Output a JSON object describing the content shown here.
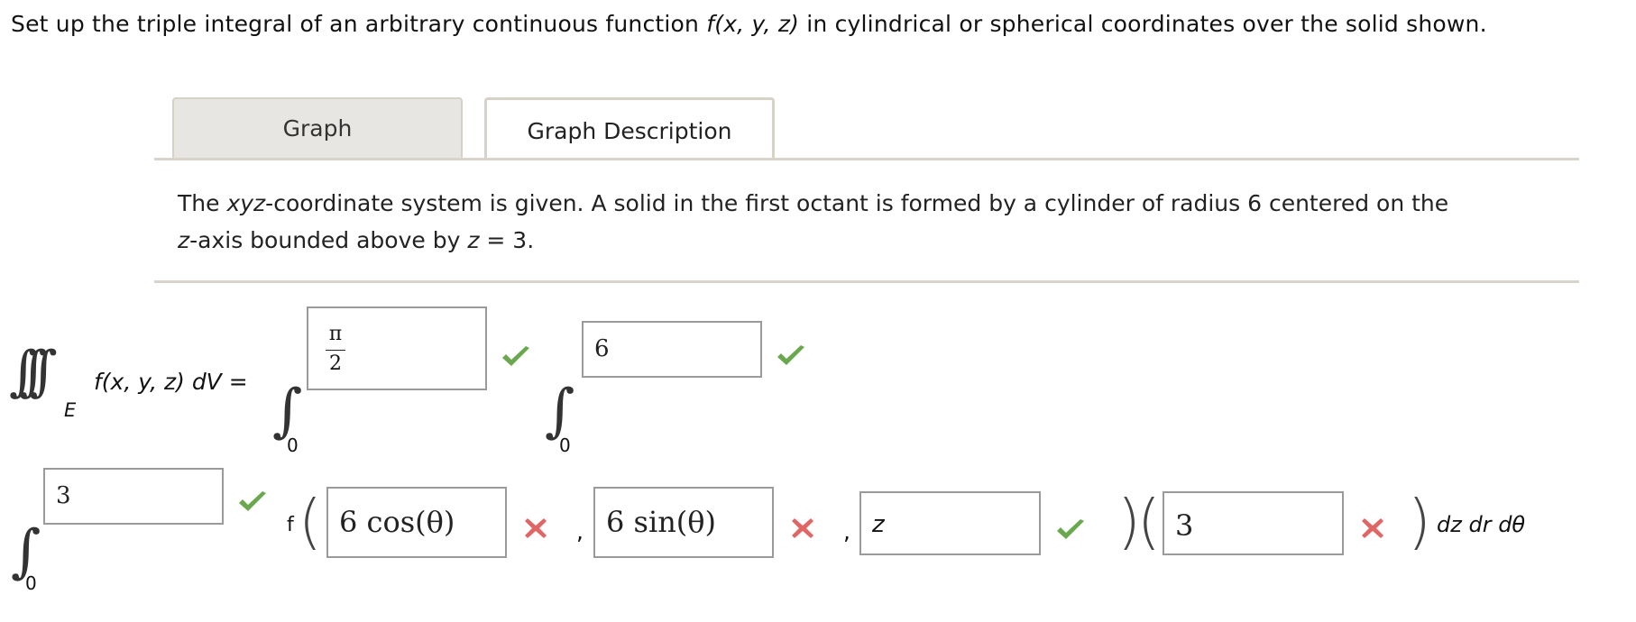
{
  "prompt": {
    "before_f": "Set up the triple integral of an arbitrary continuous function ",
    "f": "f(x, y, z)",
    "after_f": " in cylindrical or spherical coordinates over the solid shown."
  },
  "tabs": {
    "graph": "Graph",
    "graph_description": "Graph Description"
  },
  "description": {
    "part1": "The ",
    "xyz": "xyz",
    "part2": "-coordinate system is given. A solid in the first octant is formed by a cylinder of radius 6 centered on the ",
    "z": "z",
    "part3": "-axis bounded above by ",
    "z2": "z",
    "part4": " = 3."
  },
  "integral": {
    "region": "E",
    "integrand": "f(x, y, z) dV =",
    "outer": {
      "lower": "0",
      "upper_numerator": "π",
      "upper_denominator": "2",
      "upper_status": "correct"
    },
    "middle": {
      "lower": "0",
      "upper": "6",
      "upper_status": "correct"
    },
    "inner": {
      "lower": "0",
      "upper": "3",
      "upper_status": "correct"
    },
    "function_label": "f",
    "arg_x": {
      "value": "6 cos(θ)",
      "status": "incorrect"
    },
    "comma": ",",
    "arg_y": {
      "value": "6 sin(θ)",
      "status": "incorrect"
    },
    "arg_z": {
      "value": "z",
      "status": "correct"
    },
    "jacobian": {
      "value": "3",
      "status": "incorrect"
    },
    "differentials": "dz dr dθ"
  },
  "colors": {
    "check": "#6aa84f",
    "cross": "#e06666",
    "tab_border": "#d6d2c8",
    "inactive_tab_bg": "#e8e6e2"
  }
}
